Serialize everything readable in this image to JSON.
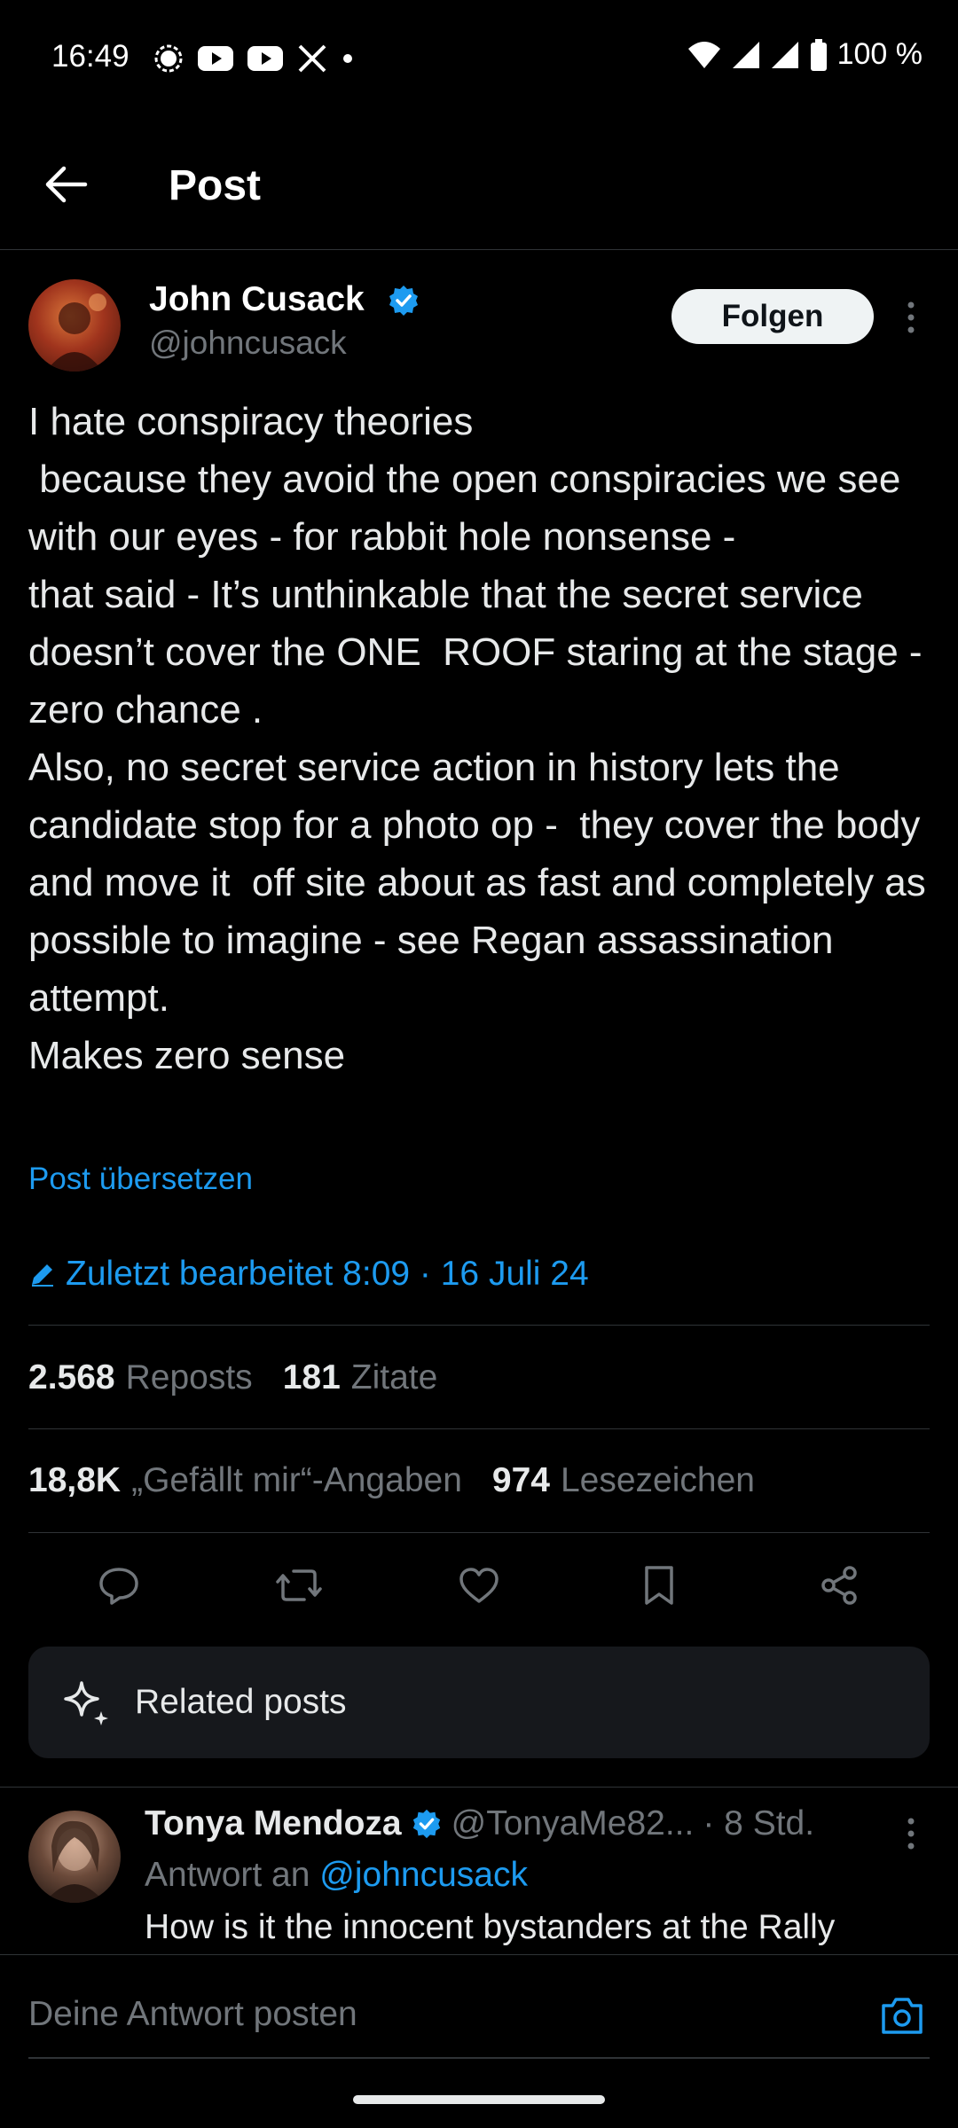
{
  "status_bar": {
    "time": "16:49",
    "battery": "100 %",
    "icons_left": [
      "signal-app-icon",
      "youtube-icon",
      "youtube-icon",
      "x-icon",
      "dot-icon"
    ],
    "icons_right": [
      "wifi-icon",
      "cell-signal-icon",
      "cell-signal-icon",
      "battery-icon"
    ]
  },
  "header": {
    "title": "Post"
  },
  "post": {
    "author_name": "John Cusack",
    "author_handle": "@johncusack",
    "follow_label": "Folgen",
    "text": "I hate conspiracy theories\n because they avoid the open conspiracies we see with our eyes - for rabbit hole nonsense -\nthat said - It’s unthinkable that the secret service doesn’t cover the ONE  ROOF staring at the stage - zero chance .\nAlso, no secret service action in history lets the candidate stop for a photo op -  they cover the body and move it  off site about as fast and completely as possible to imagine - see Regan assassination attempt.\nMakes zero sense",
    "translate_label": "Post übersetzen",
    "edited_label": "Zuletzt bearbeitet 8:09 · 16 Juli 24"
  },
  "stats": {
    "reposts_count": "2.568",
    "reposts_label": "Reposts",
    "quotes_count": "181",
    "quotes_label": "Zitate",
    "likes_count": "18,8K",
    "likes_label": "„Gefällt mir“-Angaben",
    "bookmarks_count": "974",
    "bookmarks_label": "Lesezeichen"
  },
  "actions": [
    "reply-icon",
    "repost-icon",
    "like-icon",
    "bookmark-icon",
    "share-icon"
  ],
  "related": {
    "label": "Related posts"
  },
  "reply": {
    "name": "Tonya Mendoza",
    "handle": "@TonyaMe82...",
    "time": "· 8 Std.",
    "reply_to_prefix": "Antwort an",
    "reply_to_handle": "@johncusack",
    "text": "How is it the innocent bystanders at the Rally"
  },
  "composer": {
    "placeholder": "Deine Antwort posten"
  },
  "colors": {
    "background": "#000000",
    "accent": "#1d9bf0",
    "text": "#e7e9ea",
    "muted": "#71767b",
    "divider": "#2f3336"
  }
}
